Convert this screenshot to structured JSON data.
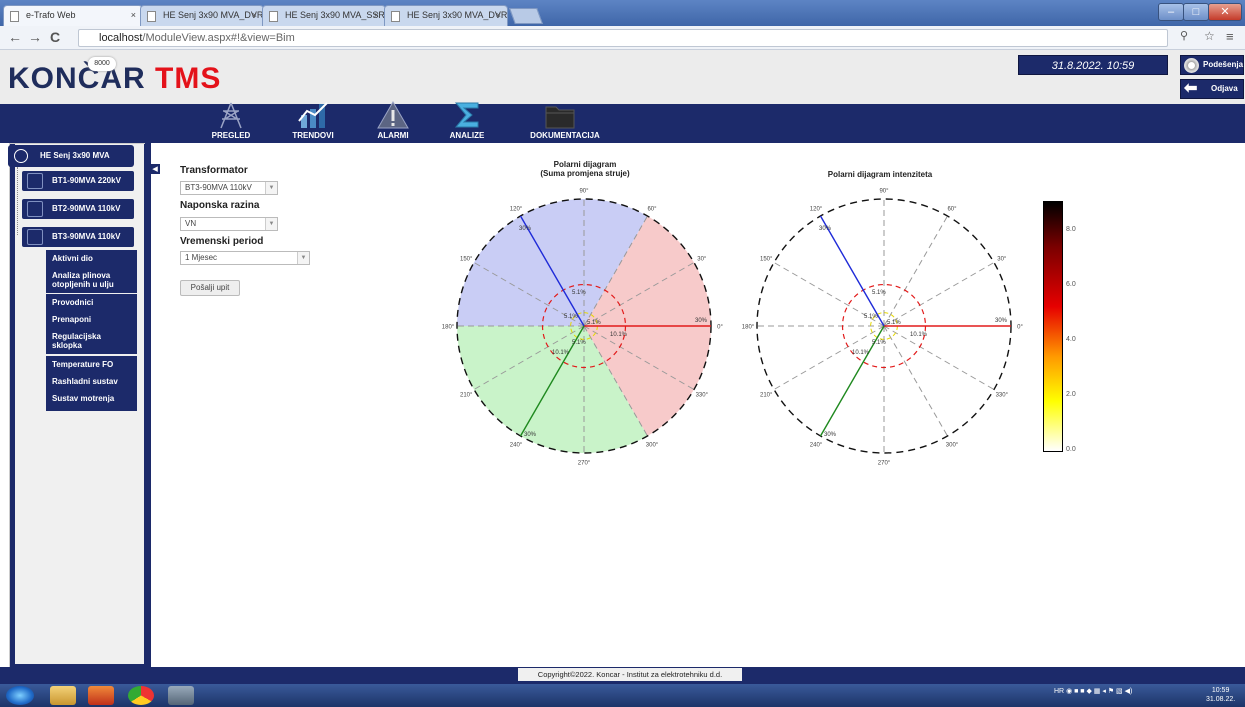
{
  "browser": {
    "tabs": [
      {
        "label": "e-Trafo Web",
        "close": "×"
      },
      {
        "label": "HE Senj 3x90 MVA_DVR_2",
        "close": "×"
      },
      {
        "label": "HE Senj 3x90 MVA_SSR_2",
        "close": "×"
      },
      {
        "label": "HE Senj 3x90 MVA_DVR_2",
        "close": "×"
      }
    ],
    "url_host": "localhost",
    "url_path": "/ModuleView.aspx#!&view=Bim",
    "window_buttons": {
      "min": "–",
      "max": "□",
      "close": "✕"
    }
  },
  "header": {
    "logo_koncar": "KONČAR",
    "logo_tms": "TMS",
    "badge": "8000",
    "datetime": "31.8.2022. 10:59",
    "settings_label": "Podešenja",
    "logout_label": "Odjava"
  },
  "nav": [
    {
      "label": "PREGLED"
    },
    {
      "label": "TRENDOVI"
    },
    {
      "label": "ALARMI"
    },
    {
      "label": "ANALIZE"
    },
    {
      "label": "DOKUMENTACIJA"
    }
  ],
  "tree": {
    "root": "HE Senj 3x90 MVA",
    "nodes": [
      "BT1-90MVA 220kV",
      "BT2-90MVA 110kV",
      "BT3-90MVA 110kV"
    ],
    "subitems": [
      "Aktivni dio",
      "Analiza plinova otopljenih u ulju",
      "Provodnici",
      "Prenaponi",
      "Regulacijska sklopka",
      "Temperature FO",
      "Rashladni sustav",
      "Sustav motrenja"
    ]
  },
  "form": {
    "transformer_label": "Transformator",
    "transformer_value": "BT3-90MVA 110kV",
    "voltage_label": "Naponska razina",
    "voltage_value": "VN",
    "period_label": "Vremenski period",
    "period_value": "1 Mjesec",
    "submit_label": "Pošalji upit"
  },
  "chart_data": [
    {
      "type": "polar",
      "title": "Polarni dijagram",
      "subtitle": "(Suma promjena struje)",
      "angle_ticks": [
        "0°",
        "30°",
        "60°",
        "90°",
        "120°",
        "150°",
        "180°",
        "210°",
        "240°",
        "270°",
        "300°",
        "330°"
      ],
      "radial_labels": [
        "5.1%",
        "10.1%",
        "30%"
      ],
      "phases": [
        {
          "angle": 0,
          "magnitude": 30,
          "color": "#e21b1b",
          "sector": [
            -60,
            60
          ],
          "fill": "#f7caca"
        },
        {
          "angle": 120,
          "magnitude": 30,
          "color": "#1f2bd9",
          "sector": [
            60,
            180
          ],
          "fill": "#c9cdf5"
        },
        {
          "angle": 240,
          "magnitude": 30,
          "color": "#1f8a1f",
          "sector": [
            180,
            300
          ],
          "fill": "#c9f3c9"
        }
      ]
    },
    {
      "type": "polar",
      "title": "Polarni dijagram intenziteta",
      "angle_ticks": [
        "0°",
        "30°",
        "60°",
        "90°",
        "120°",
        "150°",
        "180°",
        "210°",
        "240°",
        "270°",
        "300°",
        "330°"
      ],
      "radial_labels": [
        "5.1%",
        "10.1%",
        "30%"
      ],
      "phases": [
        {
          "angle": 0,
          "magnitude": 30,
          "color": "#e21b1b"
        },
        {
          "angle": 120,
          "magnitude": 30,
          "color": "#1f2bd9"
        },
        {
          "angle": 240,
          "magnitude": 30,
          "color": "#1f8a1f"
        }
      ],
      "colorbar": {
        "ticks": [
          "8.0",
          "6.0",
          "4.0",
          "2.0",
          "0.0"
        ],
        "range": [
          0,
          9.2
        ]
      }
    }
  ],
  "footer": {
    "copyright": "Copyright©2022. Koncar - Institut za elektrotehniku d.d."
  },
  "taskbar": {
    "tray": "HR",
    "time": "10:59",
    "date": "31.08.22."
  }
}
